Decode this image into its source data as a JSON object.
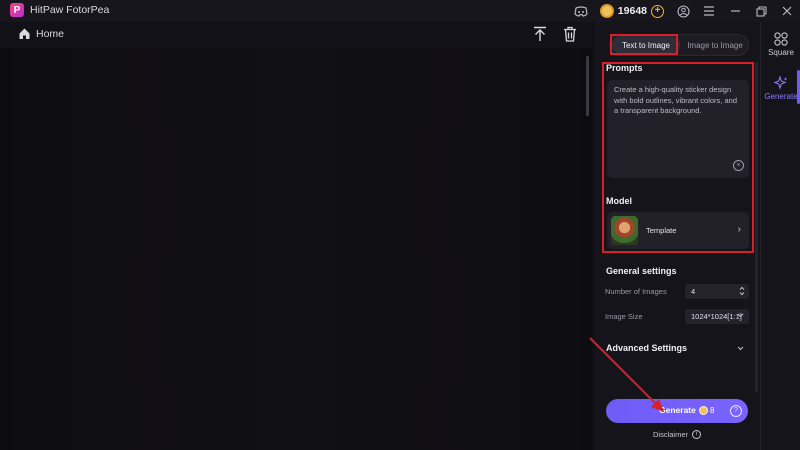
{
  "app": {
    "title": "HitPaw FotorPea",
    "logo_letter": "P"
  },
  "titlebar": {
    "coins": "19648",
    "coin_add": "+"
  },
  "toolbar": {
    "home_label": "Home"
  },
  "panel": {
    "tabs": [
      {
        "label": "Text to Image"
      },
      {
        "label": "Image to Image"
      }
    ],
    "prompts": {
      "title": "Prompts",
      "text": "Create a high-quality sticker design with bold outlines, vibrant colors, and a transparent background.",
      "clear_glyph": "×"
    },
    "model": {
      "title": "Model",
      "name": "Template",
      "chevron": "›"
    },
    "general": {
      "title": "General settings",
      "number_label": "Number of Images",
      "number_value": "4",
      "size_label": "Image Size",
      "size_value": "1024*1024[1:1]"
    },
    "advanced": {
      "title": "Advanced Settings"
    },
    "generate": {
      "label": "Generate",
      "cost": "8",
      "help": "?"
    },
    "disclaimer": {
      "label": "Disclaimer",
      "info": "i"
    }
  },
  "sidebar": {
    "items": [
      {
        "label": "Square"
      },
      {
        "label": "Generate"
      }
    ]
  },
  "colors": {
    "accent": "#6f5cf5",
    "highlight": "#d8202a",
    "coin": "#f2c25a"
  }
}
